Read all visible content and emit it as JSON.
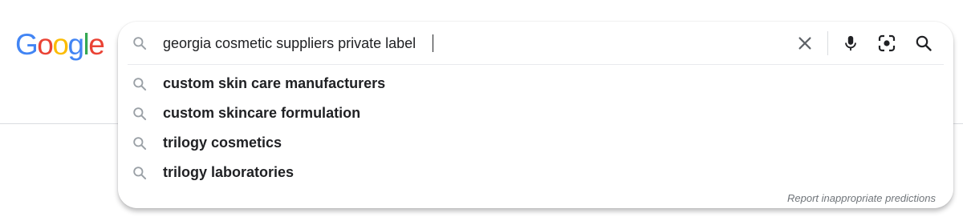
{
  "logo": {
    "letters": [
      "G",
      "o",
      "o",
      "g",
      "l",
      "e"
    ],
    "colors": [
      "#4285F4",
      "#EA4335",
      "#FBBC05",
      "#4285F4",
      "#34A853",
      "#EA4335"
    ]
  },
  "search": {
    "query": "georgia cosmetic suppliers private label",
    "icon": "search-icon",
    "tools": [
      "clear-icon",
      "microphone-icon",
      "lens-icon",
      "search-icon"
    ]
  },
  "suggestions": [
    "custom skin care manufacturers",
    "custom skincare formulation",
    "trilogy cosmetics",
    "trilogy laboratories"
  ],
  "report_link": "Report inappropriate predictions",
  "colors": {
    "text": "#202124",
    "icon_gray": "#9aa0a6",
    "tool_gray": "#5f6368",
    "lens_blue": "#4285F4"
  }
}
